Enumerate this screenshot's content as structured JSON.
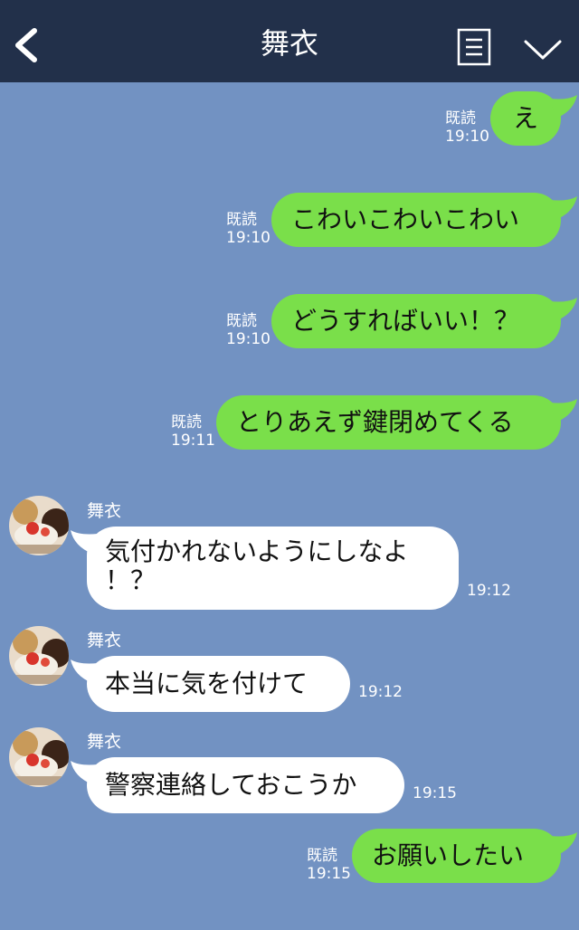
{
  "header": {
    "title": "舞衣",
    "back_icon": "chevron-left-icon",
    "menu_icon": "notes-icon",
    "collapse_icon": "chevron-down-icon"
  },
  "colors": {
    "header_bg": "#22304a",
    "chat_bg": "#7292c2",
    "outgoing_bubble": "#7adf4a",
    "incoming_bubble": "#ffffff"
  },
  "messages": [
    {
      "dir": "out",
      "text": "え",
      "read": "既読",
      "time": "19:10"
    },
    {
      "dir": "out",
      "text": "こわいこわいこわい",
      "read": "既読",
      "time": "19:10"
    },
    {
      "dir": "out",
      "text": "どうすればいい！？",
      "read": "既読",
      "time": "19:10"
    },
    {
      "dir": "out",
      "text": "とりあえず鍵閉めてくる",
      "read": "既読",
      "time": "19:11"
    },
    {
      "dir": "in",
      "sender": "舞衣",
      "line1": "気付かれないようにしなよ",
      "line2": "！？",
      "time": "19:12"
    },
    {
      "dir": "in",
      "sender": "舞衣",
      "text": "本当に気を付けて",
      "time": "19:12"
    },
    {
      "dir": "in",
      "sender": "舞衣",
      "text": "警察連絡しておこうか",
      "time": "19:15"
    },
    {
      "dir": "out",
      "text": "お願いしたい",
      "read": "既読",
      "time": "19:15"
    }
  ]
}
